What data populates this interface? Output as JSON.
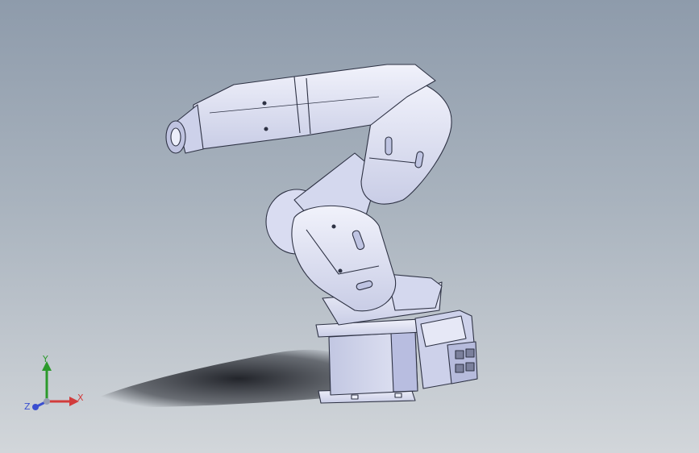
{
  "viewport": {
    "background_top": "#8e9bab",
    "background_bottom": "#d2d6da",
    "model_fill": "#dfe2f4",
    "model_shade": "#c4c9e3",
    "model_edge": "#2e3244"
  },
  "triad": {
    "x_label": "X",
    "y_label": "Y",
    "z_label": "Z",
    "x_color": "#d23c3c",
    "y_color": "#2c9a2c",
    "z_color": "#3a4fd0"
  }
}
